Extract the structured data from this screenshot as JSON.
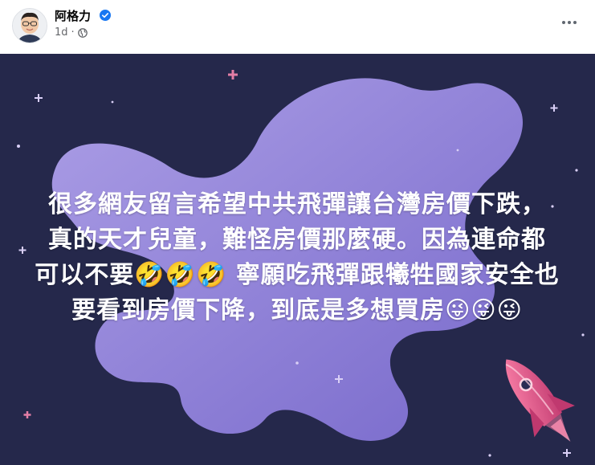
{
  "post": {
    "author": "阿格力",
    "timestamp": "1d",
    "separator": "·",
    "audience_icon": "globe-icon",
    "verified_icon": "verified-badge-icon",
    "more_icon": "more-options-icon",
    "text_lines": [
      "很多網友留言希望中共飛彈讓台灣房價下跌，",
      "真的天才兒童，難怪房價那麼硬。因為連命都",
      "可以不要🤣🤣🤣 寧願吃飛彈跟犧牲國家安全也",
      "要看到房價下降，到底是多想買房😜😜😜"
    ],
    "image": {
      "background_color": "#25284b",
      "accent_color": "#8e7be0",
      "rocket_color": "#e0588a"
    }
  }
}
